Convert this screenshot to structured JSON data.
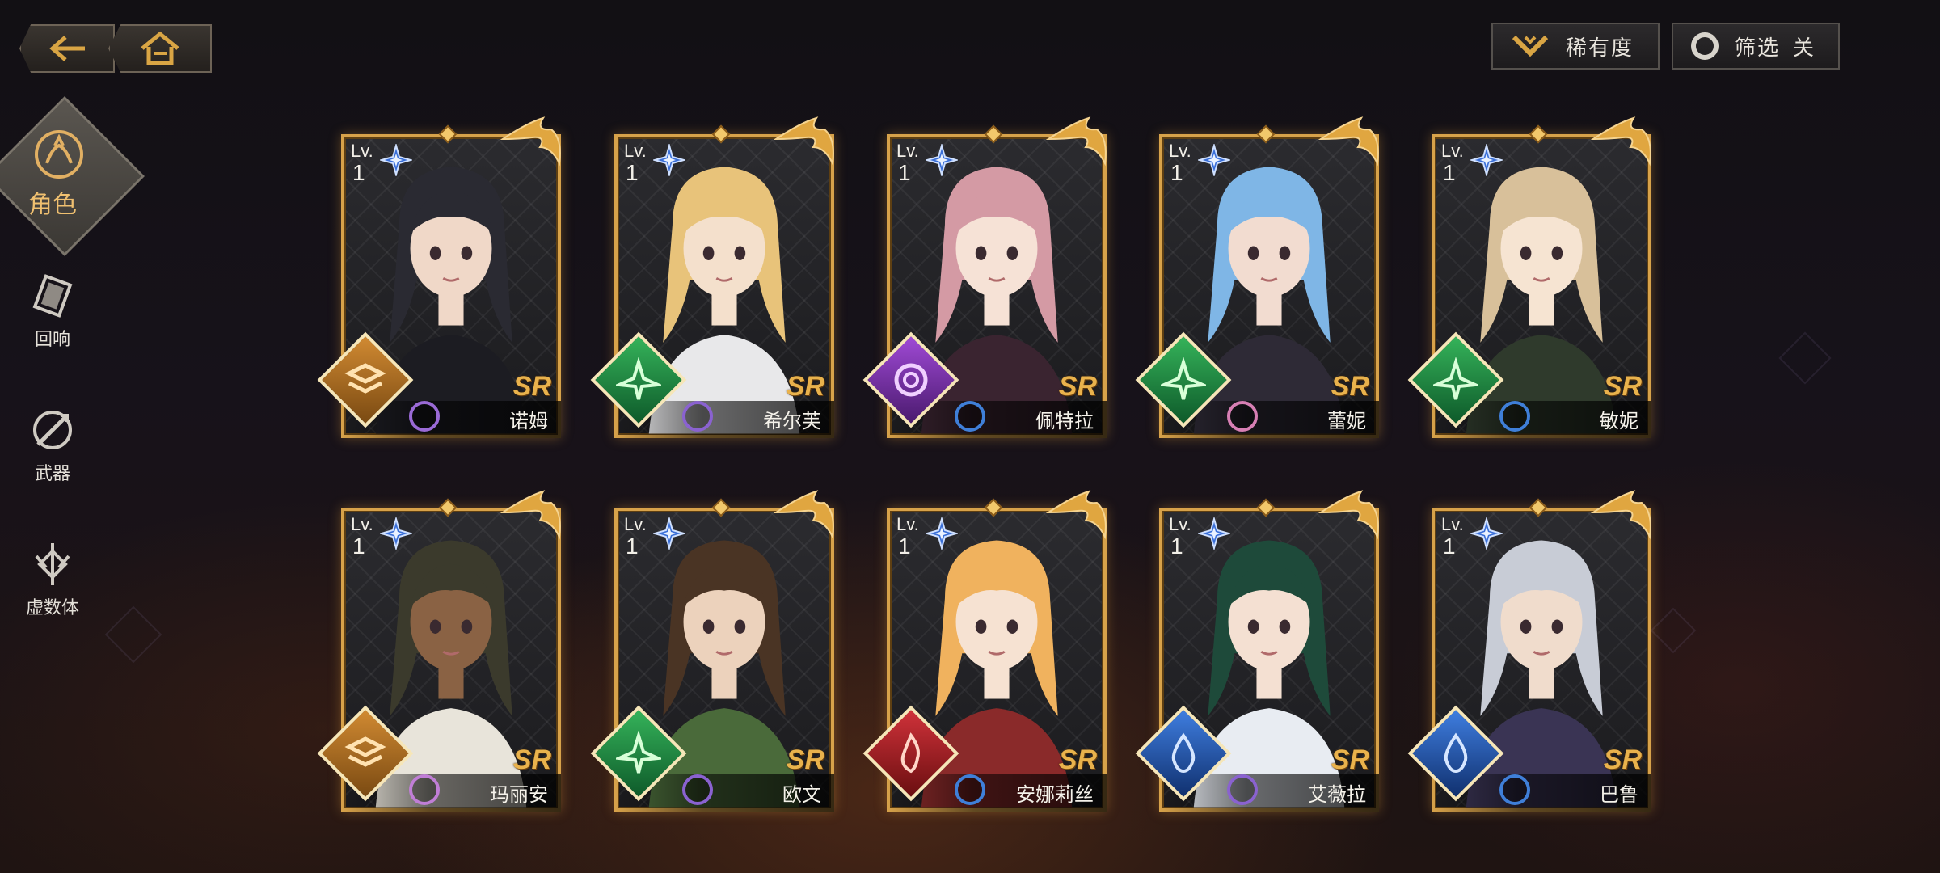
{
  "nav": {
    "back": "back-arrow",
    "home": "home"
  },
  "top": {
    "rarity_label": "稀有度",
    "filter_label": "筛选",
    "filter_state": "关"
  },
  "sidebar": {
    "items": [
      {
        "label": "角色",
        "icon": "character-icon",
        "active": true
      },
      {
        "label": "回响",
        "icon": "echo-icon",
        "active": false
      },
      {
        "label": "武器",
        "icon": "weapon-icon",
        "active": false
      },
      {
        "label": "虚数体",
        "icon": "imaginary-icon",
        "active": false
      }
    ]
  },
  "cards": [
    {
      "lv_label": "Lv.",
      "level": "1",
      "rarity": "SR",
      "name": "诺姆",
      "element": "orange",
      "hair": "#2a2a32",
      "skin": "#f0d8c8",
      "outfit": "#1c1c22",
      "orb": "#9a6ad6"
    },
    {
      "lv_label": "Lv.",
      "level": "1",
      "rarity": "SR",
      "name": "希尔芙",
      "element": "green",
      "hair": "#e8c37a",
      "skin": "#f4e0cc",
      "outfit": "#e8e8ea",
      "orb": "#8a62d0"
    },
    {
      "lv_label": "Lv.",
      "level": "1",
      "rarity": "SR",
      "name": "佩特拉",
      "element": "purple",
      "hair": "#d49aa4",
      "skin": "#f6e2d6",
      "outfit": "#3a2430",
      "orb": "#3f7fd8"
    },
    {
      "lv_label": "Lv.",
      "level": "1",
      "rarity": "SR",
      "name": "蕾妮",
      "element": "green",
      "hair": "#7fb6e6",
      "skin": "#f2dcd0",
      "outfit": "#2e2a36",
      "orb": "#d77fb4"
    },
    {
      "lv_label": "Lv.",
      "level": "1",
      "rarity": "SR",
      "name": "敏妮",
      "element": "green",
      "hair": "#d8c09a",
      "skin": "#f6e4d2",
      "outfit": "#2f3a2c",
      "orb": "#3f7fd8"
    },
    {
      "lv_label": "Lv.",
      "level": "1",
      "rarity": "SR",
      "name": "玛丽安",
      "element": "orange",
      "hair": "#3b3a2c",
      "skin": "#8a6244",
      "outfit": "#e8e4da",
      "orb": "#c07ed6"
    },
    {
      "lv_label": "Lv.",
      "level": "1",
      "rarity": "SR",
      "name": "欧文",
      "element": "green",
      "hair": "#4a3424",
      "skin": "#ecd2bc",
      "outfit": "#4a6a3a",
      "orb": "#8a62d0"
    },
    {
      "lv_label": "Lv.",
      "level": "1",
      "rarity": "SR",
      "name": "安娜莉丝",
      "element": "red",
      "hair": "#f0b25e",
      "skin": "#f6e2d2",
      "outfit": "#8a2a2a",
      "orb": "#3f7fd8"
    },
    {
      "lv_label": "Lv.",
      "level": "1",
      "rarity": "SR",
      "name": "艾薇拉",
      "element": "blue",
      "hair": "#1e4a3a",
      "skin": "#f4e0d2",
      "outfit": "#e8ecf2",
      "orb": "#8a62d0"
    },
    {
      "lv_label": "Lv.",
      "level": "1",
      "rarity": "SR",
      "name": "巴鲁",
      "element": "blue",
      "hair": "#c8ccd6",
      "skin": "#f0dccc",
      "outfit": "#3a3454",
      "orb": "#3f7fd8"
    }
  ],
  "colors": {
    "accent_gold": "#d7a24a",
    "active_tab": "#f0c070",
    "element_orange": "#c9812e",
    "element_green": "#2f9e4a",
    "element_purple": "#8a3fc0",
    "element_red": "#b8262a",
    "element_blue": "#2a5fc0"
  }
}
